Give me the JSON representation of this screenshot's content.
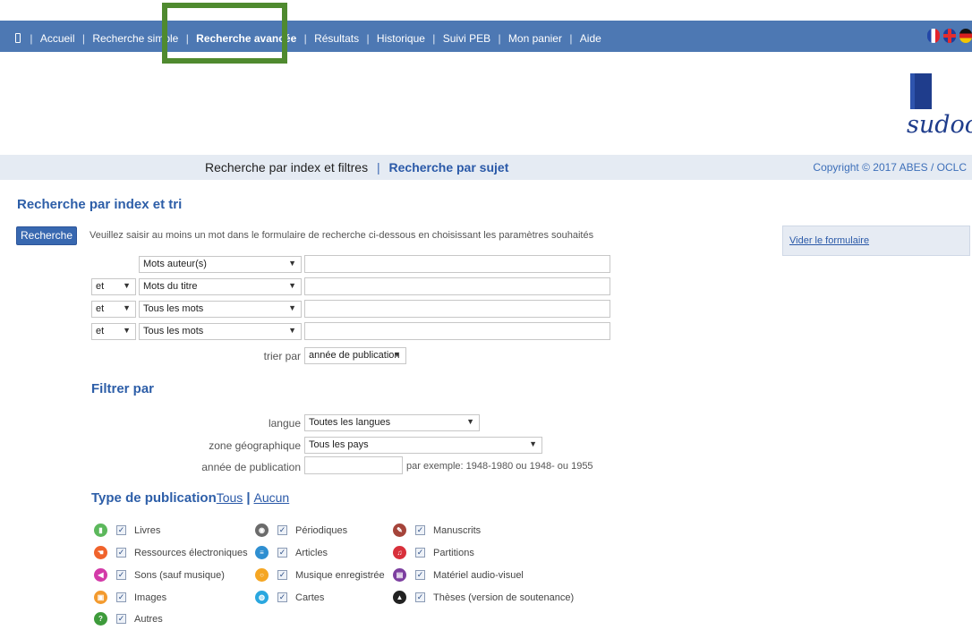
{
  "nav": {
    "items": [
      "Accueil",
      "Recherche simple",
      "Recherche avancée",
      "Résultats",
      "Historique",
      "Suivi PEB",
      "Mon panier",
      "Aide"
    ],
    "active": "Recherche avancée",
    "separator": "|"
  },
  "logo": {
    "text": "sudoc"
  },
  "subbar": {
    "current": "Recherche par index et filtres",
    "separator": "|",
    "link": "Recherche par sujet",
    "copyright": "Copyright © 2017 ABES / OCLC"
  },
  "section_title": "Recherche par index et tri",
  "search_button": "Recherche",
  "instructions": "Veuillez saisir au moins un mot dans le formulaire de recherche ci-dessous en choisissant les paramètres souhaités",
  "side_link": "Vider le formulaire",
  "rows": [
    {
      "operator": "",
      "field": "Mots auteur(s)",
      "value": ""
    },
    {
      "operator": "et",
      "field": "Mots du titre",
      "value": ""
    },
    {
      "operator": "et",
      "field": "Tous les mots",
      "value": ""
    },
    {
      "operator": "et",
      "field": "Tous les mots",
      "value": ""
    }
  ],
  "sort": {
    "label": "trier par",
    "value": "année de publication"
  },
  "filter": {
    "title": "Filtrer par",
    "langue_label": "langue",
    "langue_value": "Toutes les langues",
    "zone_label": "zone géographique",
    "zone_value": "Tous les pays",
    "annee_label": "année de publication",
    "annee_value": "",
    "annee_hint": "par exemple: 1948-1980 ou 1948- ou 1955"
  },
  "pub_types": {
    "title": "Type de publication",
    "all": "Tous",
    "sep": "|",
    "none": "Aucun",
    "items": [
      {
        "name": "Livres",
        "icon": "book-icon",
        "color": "#5cb85c",
        "checked": true
      },
      {
        "name": "Ressources électroniques",
        "icon": "electronic-resource-icon",
        "color": "#f0632c",
        "checked": true
      },
      {
        "name": "Sons (sauf musique)",
        "icon": "speaker-icon",
        "color": "#d33aa8",
        "checked": true
      },
      {
        "name": "Images",
        "icon": "image-icon",
        "color": "#f39a2e",
        "checked": true
      },
      {
        "name": "Autres",
        "icon": "question-icon",
        "color": "#3e9b3b",
        "checked": true
      },
      {
        "name": "Périodiques",
        "icon": "periodical-icon",
        "color": "#6b6b6b",
        "checked": true
      },
      {
        "name": "Articles",
        "icon": "article-icon",
        "color": "#2f8fd1",
        "checked": true
      },
      {
        "name": "Musique enregistrée",
        "icon": "recorded-music-icon",
        "color": "#f5a623",
        "checked": true
      },
      {
        "name": "Cartes",
        "icon": "map-icon",
        "color": "#2aa7df",
        "checked": true
      },
      {
        "name": "Manuscrits",
        "icon": "manuscript-icon",
        "color": "#a5443a",
        "checked": true
      },
      {
        "name": "Partitions",
        "icon": "score-icon",
        "color": "#d8303b",
        "checked": true
      },
      {
        "name": "Matériel audio-visuel",
        "icon": "audiovisual-icon",
        "color": "#7d3fa0",
        "checked": true
      },
      {
        "name": "Thèses (version de soutenance)",
        "icon": "thesis-icon",
        "color": "#222222",
        "checked": true
      }
    ]
  },
  "colors": {
    "nav_bg": "#4d78b3",
    "highlight": "#4f8a2f",
    "accent": "#2d5ea8",
    "subbar_bg": "#e5ebf3"
  }
}
